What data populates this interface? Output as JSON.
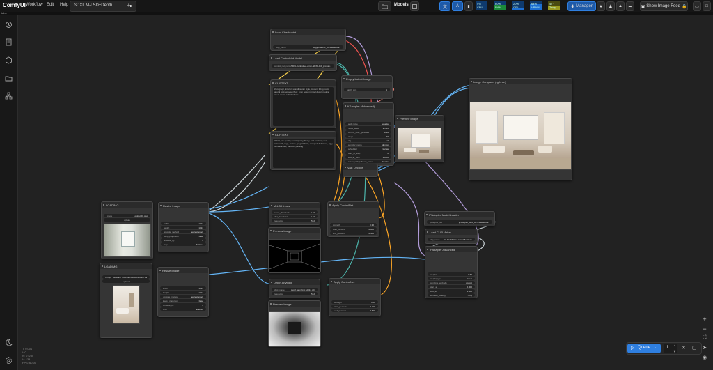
{
  "topbar": {
    "brand": "ComfyUI",
    "menu": [
      "Workflow",
      "Edit",
      "Help"
    ],
    "tab_title": "SDXL M-LSD+Depth...",
    "models_label": "Models",
    "meters": [
      {
        "name": "CPU",
        "value": "4%",
        "fill": 0.04
      },
      {
        "name": "RAM",
        "value": "60%",
        "fill": 0.6
      },
      {
        "name": "GPU",
        "value": "20%",
        "fill": 0.2
      },
      {
        "name": "VRAM",
        "value": "64%",
        "fill": 0.64
      },
      {
        "name": "Temp",
        "value": "47°",
        "fill": 0.47
      }
    ],
    "manager_label": "Manager",
    "image_feed_label": "Show Image Feed"
  },
  "subbar": {
    "text": "tabs"
  },
  "sidebar": {
    "icons": [
      "history-icon",
      "queue-icon",
      "node-library-icon",
      "model-library-icon",
      "workflows-icon",
      "theme-icon",
      "settings-icon"
    ]
  },
  "nodes": {
    "ckpt": {
      "title": "Load Checkpoint",
      "widget_key": "ckpt_name",
      "widget_val": "JuggernautXL_v9.safetensors"
    },
    "cnet_loader": {
      "title": "Load ControlNet Model",
      "widget_key": "control_net_name",
      "widget_val": "SDXL/controlnet-union-SDXL-1.0_promax.safetensors"
    },
    "empty_latent": {
      "title": "Empty Latent Image",
      "widget_key": "batch_size",
      "widget_val": "1"
    },
    "pos": {
      "title": "CLIPTEXT",
      "text": "photograph, interior, scandinavian style, modern living room, natural light, wooden floor, linen sofa, minimal decor, neutral tones, warm, soft shadows"
    },
    "neg": {
      "title": "CLIPTEXT",
      "text": "NSFW, low quality, worst quality, blurry, bad anatomy, text, watermark, logo, lowres, jpeg artifacts, cropped, deformed, ugly, oversaturated, cartoon, painting"
    },
    "ksampler": {
      "title": "KSampler (Advanced)",
      "widgets": [
        [
          "add_noise",
          "enable"
        ],
        [
          "noise_seed",
          "97412"
        ],
        [
          "control_after_generate",
          "fixed"
        ],
        [
          "steps",
          "30"
        ],
        [
          "cfg",
          "5.0"
        ],
        [
          "sampler_name",
          "dpmpp"
        ],
        [
          "scheduler",
          "karras"
        ],
        [
          "start_at_step",
          "0"
        ],
        [
          "end_at_step",
          "10000"
        ],
        [
          "return_with_leftover_noise",
          "disable"
        ]
      ]
    },
    "vae": {
      "title": "VAE Decode"
    },
    "preview_small": {
      "title": "Preview Image"
    },
    "compare": {
      "title": "Image Comparer (rgthree)"
    },
    "load1": {
      "title": "LOADIMG",
      "widget_key": "image",
      "widget_val": "output-01.png",
      "button": "upload"
    },
    "load2": {
      "title": "LOADIMG",
      "widget_key": "image",
      "widget_val": "8b1ca4776b87f9fc81dd5b1b99370a",
      "button": "upload"
    },
    "resize1": {
      "title": "Resize Image",
      "widgets": [
        [
          "width",
          "1024"
        ],
        [
          "height",
          "1024"
        ],
        [
          "upscale_method",
          "nearest-exact"
        ],
        [
          "keep_proportion",
          "false"
        ],
        [
          "divisible_by",
          "2"
        ],
        [
          "crop",
          "disabled"
        ]
      ]
    },
    "resize2": {
      "title": "Resize Image",
      "widgets": [
        [
          "width",
          "1024"
        ],
        [
          "height",
          "1024"
        ],
        [
          "upscale_method",
          "nearest-exact"
        ],
        [
          "keep_proportion",
          "false"
        ],
        [
          "divisible_by",
          "2"
        ],
        [
          "crop",
          "disabled"
        ]
      ]
    },
    "mlsd": {
      "title": "M-LSD Lines",
      "widgets": [
        [
          "score_threshold",
          "0.10"
        ],
        [
          "dist_threshold",
          "0.10"
        ],
        [
          "resolution",
          "512"
        ]
      ]
    },
    "preview_lines": {
      "title": "Preview Image"
    },
    "depth": {
      "title": "Depth Anything",
      "widgets": [
        [
          "ckpt_name",
          "depth_anything_vitl14.pth"
        ],
        [
          "resolution",
          "512"
        ]
      ]
    },
    "preview_depth": {
      "title": "Preview Image"
    },
    "apply1": {
      "title": "Apply ControlNet",
      "widgets": [
        [
          "strength",
          "0.30"
        ],
        [
          "start_percent",
          "0.000"
        ],
        [
          "end_percent",
          "0.500"
        ]
      ]
    },
    "apply2": {
      "title": "Apply ControlNet",
      "widgets": [
        [
          "strength",
          "0.50"
        ],
        [
          "start_percent",
          "0.000"
        ],
        [
          "end_percent",
          "0.500"
        ]
      ]
    },
    "ipadapter_loader": {
      "title": "IPAdapter Model Loader",
      "widget_key": "ipadapter_file",
      "widget_val": "ip-adapter_sdxl_vit-h.safetensors"
    },
    "clipvision": {
      "title": "Load CLIP Vision",
      "widget_key": "clip_name",
      "widget_val": "CLIP-ViT-H-14-laion2B.safetensors"
    },
    "ipadapter_adv": {
      "title": "IPAdapter Advanced",
      "widgets": [
        [
          "weight",
          "0.60"
        ],
        [
          "weight_type",
          "linear"
        ],
        [
          "combine_embeds",
          "concat"
        ],
        [
          "start_at",
          "0.000"
        ],
        [
          "end_at",
          "1.000"
        ],
        [
          "embeds_scaling",
          "V only"
        ]
      ]
    }
  },
  "queue": {
    "label": "Queue",
    "count": "1"
  },
  "stats": [
    "T: 0.00s",
    "I: 0",
    "N: 0 [28]",
    "V: 134",
    "FPS: 60.00"
  ],
  "colors": {
    "accent": "#2f7fe0",
    "model_wire": "#b39ddb",
    "clip_wire": "#ffd54f",
    "image_wire": "#64b5f6",
    "latent_wire": "#ff8a80",
    "cond_wire": "#ffa726",
    "cnet_wire": "#4db6ac",
    "vae_wire": "#ef5350",
    "text_wire": "#cfd8dc"
  }
}
